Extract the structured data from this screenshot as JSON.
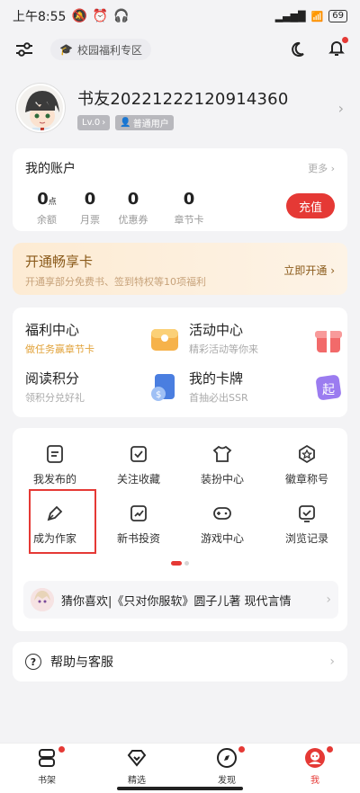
{
  "status": {
    "time": "上午8:55",
    "battery": "69"
  },
  "top": {
    "chip": "校园福利专区"
  },
  "profile": {
    "name": "书友20221222120914360",
    "level": "Lv.0",
    "role": "普通用户"
  },
  "account": {
    "title": "我的账户",
    "more": "更多",
    "stats": [
      {
        "value": "0",
        "unit": "点",
        "label": "余额"
      },
      {
        "value": "0",
        "unit": "",
        "label": "月票"
      },
      {
        "value": "0",
        "unit": "",
        "label": "优惠券"
      },
      {
        "value": "0",
        "unit": "",
        "label": "章节卡"
      }
    ],
    "recharge": "充值"
  },
  "vip": {
    "title": "开通畅享卡",
    "subtitle": "开通享部分免费书、签到特权等10项福利",
    "action": "立即开通"
  },
  "features": [
    {
      "title": "福利中心",
      "sub": "做任务赢章节卡",
      "icon": "wallet-icon"
    },
    {
      "title": "活动中心",
      "sub": "精彩活动等你来",
      "icon": "gift-icon"
    },
    {
      "title": "阅读积分",
      "sub": "领积分兑好礼",
      "icon": "points-icon"
    },
    {
      "title": "我的卡牌",
      "sub": "首抽必出SSR",
      "icon": "card-icon"
    }
  ],
  "tools": [
    {
      "label": "我发布的",
      "icon": "publish-icon"
    },
    {
      "label": "关注收藏",
      "icon": "favorite-icon"
    },
    {
      "label": "装扮中心",
      "icon": "dress-icon"
    },
    {
      "label": "徽章称号",
      "icon": "badge-icon"
    },
    {
      "label": "成为作家",
      "icon": "pen-icon"
    },
    {
      "label": "新书投资",
      "icon": "invest-icon"
    },
    {
      "label": "游戏中心",
      "icon": "gamepad-icon"
    },
    {
      "label": "浏览记录",
      "icon": "history-icon"
    }
  ],
  "recommend": "猜你喜欢|《只对你服软》圆子儿著 现代言情",
  "help": "帮助与客服",
  "tabs": [
    {
      "label": "书架"
    },
    {
      "label": "精选"
    },
    {
      "label": "发现"
    },
    {
      "label": "我"
    }
  ],
  "colors": {
    "accent": "#e53935",
    "gold": "#e2a33b"
  }
}
